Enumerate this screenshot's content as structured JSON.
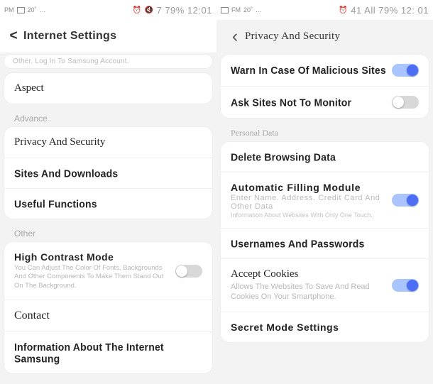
{
  "left": {
    "status": {
      "l1": "PM",
      "l2": "20˚",
      "l3": "…",
      "r": "7 79% 12:01"
    },
    "back_glyph": "<",
    "title": "Internet Settings",
    "hint": "Other. Log In To Samsung Account.",
    "aspect": "Aspect",
    "advance": "Advance",
    "privacy": "Privacy And Security",
    "sites": "Sites And Downloads",
    "useful": "Useful Functions",
    "other": "Other",
    "hc_title": "High Contrast Mode",
    "hc_desc": "You Can Adjust The Color Of Fonts, Backgrounds And Other Components To Make Them Stand Out On The Background.",
    "contact": "Contact",
    "about": "Information About The Internet Samsung"
  },
  "right": {
    "status": {
      "l1": "FM",
      "l2": "20˚",
      "l3": "…",
      "r": "41 All 79% 12: 01"
    },
    "back_glyph": "‹",
    "title": "Privacy And Security",
    "warn": "Warn In Case Of Malicious Sites",
    "ask": "Ask Sites Not To Monitor",
    "personal": "Personal Data",
    "delete": "Delete Browsing Data",
    "auto_t": "Automatic Filling Module",
    "auto_s": "Enter Name. Address. Credit Card And Other Data",
    "auto_d": "Information About Websites With Only One Touch.",
    "user": "Usernames And Passwords",
    "cookies_t": "Accept Cookies",
    "cookies_d": "Allows The Websites To Save And Read Cookies On Your Smartphone.",
    "secret": "Secret Mode Settings"
  }
}
